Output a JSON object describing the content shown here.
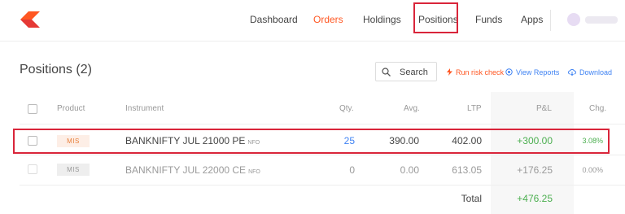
{
  "nav": {
    "items": [
      "Dashboard",
      "Orders",
      "Holdings",
      "Positions",
      "Funds",
      "Apps"
    ]
  },
  "colors": {
    "accent": "#ff5722",
    "profit": "#4caf50",
    "link": "#4184f3",
    "highlight": "#d9253a"
  },
  "positions": {
    "title": "Positions (2)",
    "search_placeholder": "Search",
    "actions": [
      "Run risk check",
      "View Reports",
      "Download"
    ],
    "columns": [
      "Product",
      "Instrument",
      "Qty.",
      "Avg.",
      "LTP",
      "P&L",
      "Chg."
    ],
    "rows": [
      {
        "product": "MIS",
        "instrument": "BANKNIFTY JUL 21000 PE",
        "exchange": "NFO",
        "qty": "25",
        "avg": "390.00",
        "ltp": "402.00",
        "pnl": "+300.00",
        "chg": "3.08%"
      },
      {
        "product": "MIS",
        "instrument": "BANKNIFTY JUL 22000 CE",
        "exchange": "NFO",
        "qty": "0",
        "avg": "0.00",
        "ltp": "613.05",
        "pnl": "+176.25",
        "chg": "0.00%"
      }
    ],
    "total_label": "Total",
    "total_pnl": "+476.25"
  },
  "icons": {
    "logo": "kite-logo",
    "search": "search-icon",
    "risk": "bolt-icon",
    "reports": "target-icon",
    "download": "cloud-download-icon"
  }
}
